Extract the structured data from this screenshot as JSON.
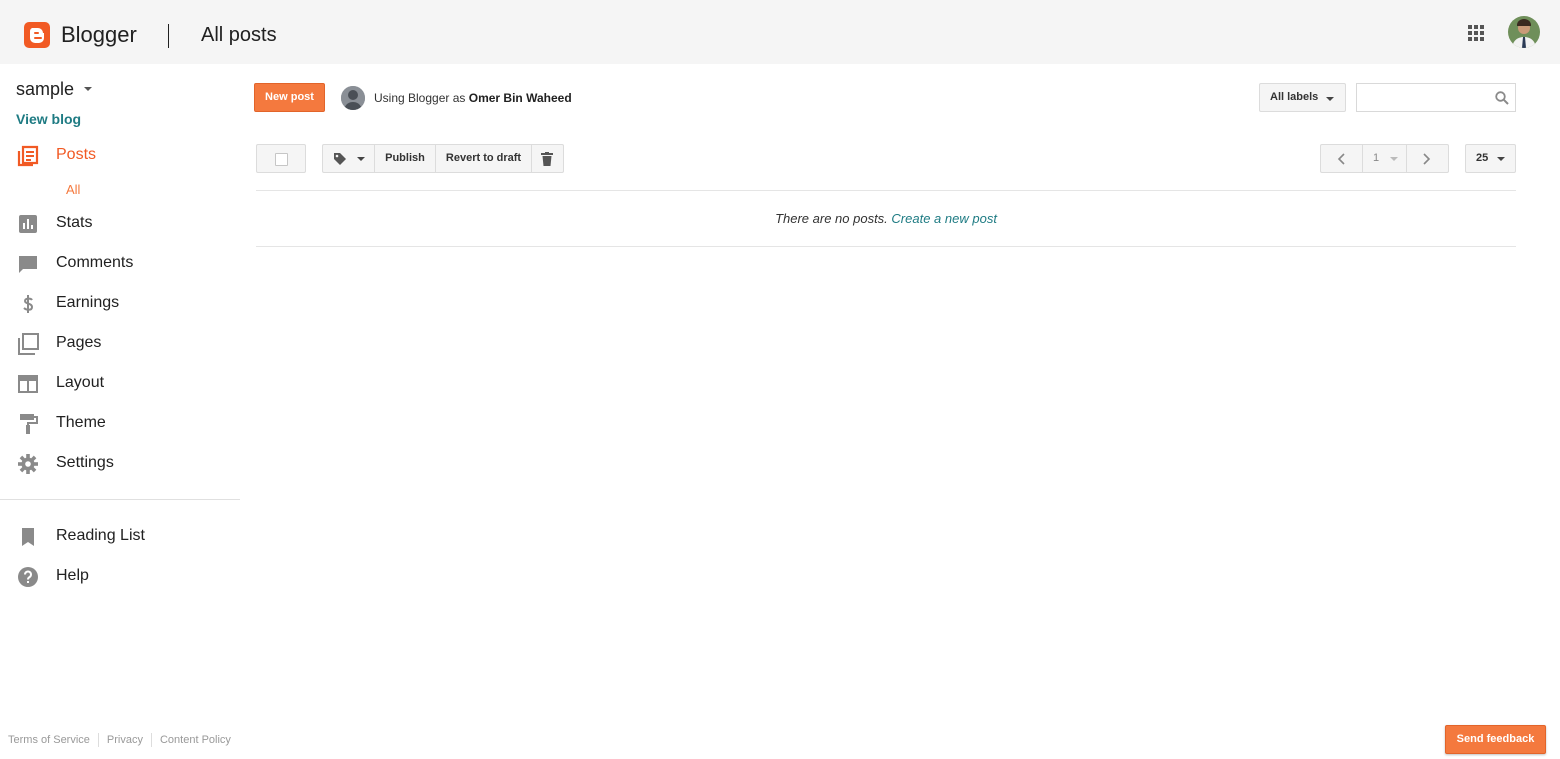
{
  "header": {
    "brand": "Blogger",
    "page_title": "All posts"
  },
  "sidebar": {
    "blog_name": "sample",
    "view_blog": "View blog",
    "items": [
      {
        "label": "Posts",
        "icon": "posts-icon",
        "active": true
      },
      {
        "label": "Stats",
        "icon": "stats-icon"
      },
      {
        "label": "Comments",
        "icon": "comments-icon"
      },
      {
        "label": "Earnings",
        "icon": "dollar-icon"
      },
      {
        "label": "Pages",
        "icon": "pages-icon"
      },
      {
        "label": "Layout",
        "icon": "layout-icon"
      },
      {
        "label": "Theme",
        "icon": "paint-roller-icon"
      },
      {
        "label": "Settings",
        "icon": "gear-icon"
      }
    ],
    "posts_sub": "All",
    "secondary_items": [
      {
        "label": "Reading List",
        "icon": "bookmark-icon"
      },
      {
        "label": "Help",
        "icon": "help-icon"
      }
    ],
    "footer_links": [
      "Terms of Service",
      "Privacy",
      "Content Policy"
    ]
  },
  "main": {
    "new_post": "New post",
    "using_prefix": "Using Blogger as",
    "user_name": "Omer Bin Waheed",
    "labels_filter": "All labels",
    "toolbar": {
      "publish": "Publish",
      "revert": "Revert to draft"
    },
    "pager": {
      "page": "1",
      "per_page": "25"
    },
    "empty_message": "There are no posts.",
    "create_link": "Create a new post",
    "send_feedback": "Send feedback"
  },
  "colors": {
    "accent": "#f4793e",
    "active_nav": "#f15a24",
    "link": "#1e7b83",
    "header_bg": "#f5f5f5"
  }
}
